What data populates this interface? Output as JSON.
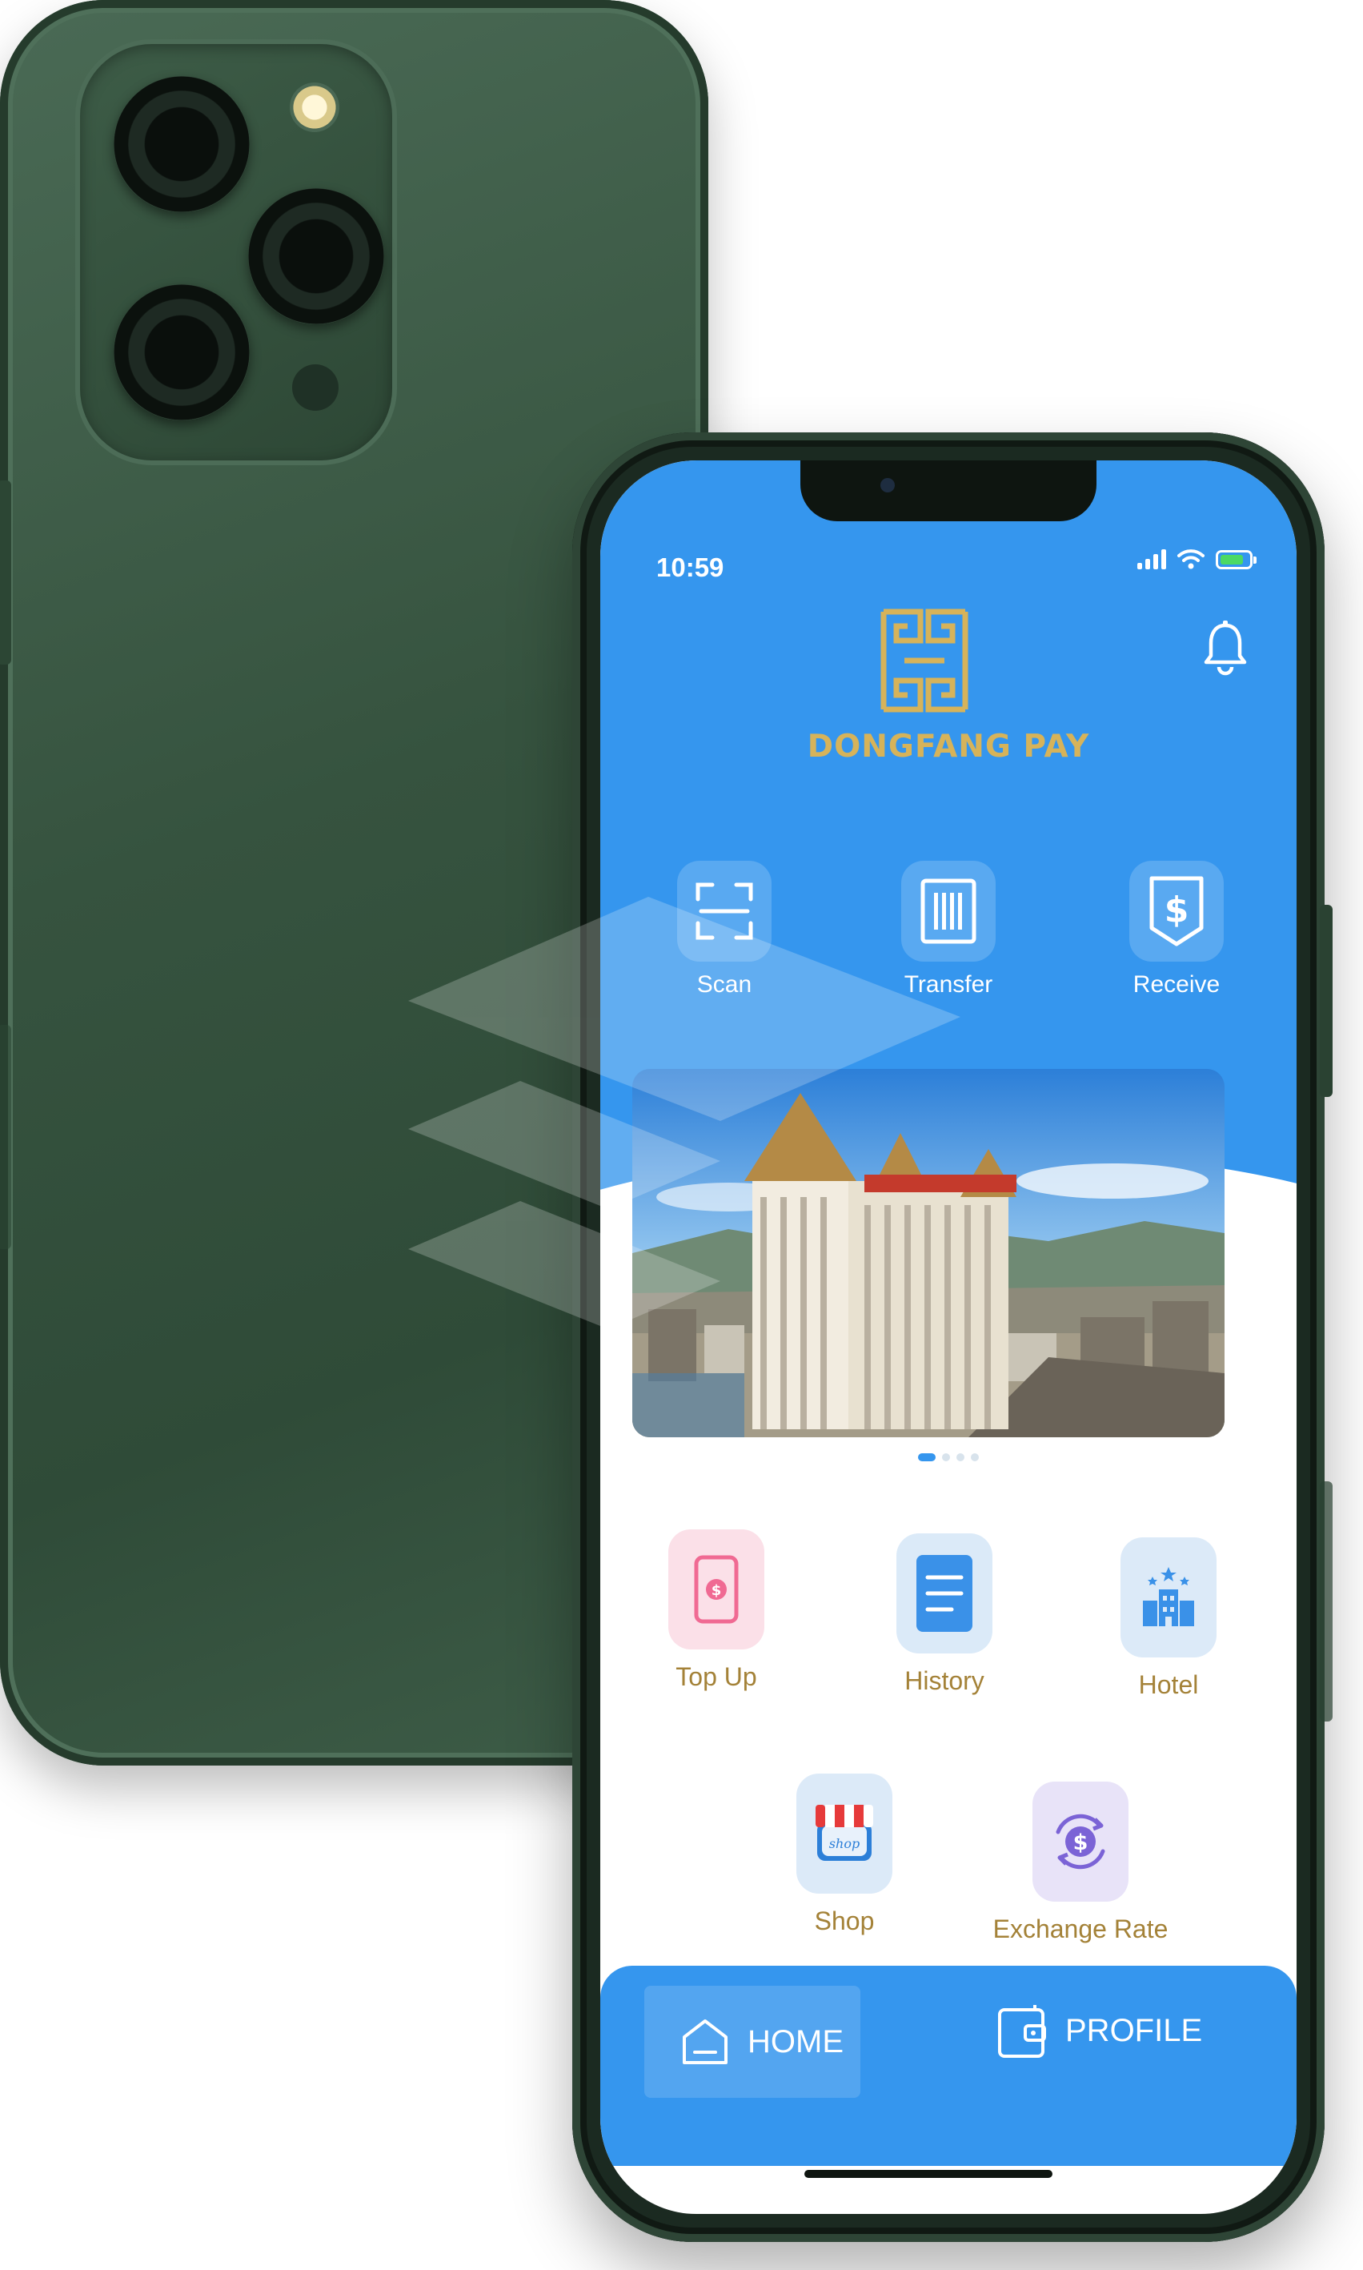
{
  "status_bar": {
    "time": "10:59"
  },
  "brand": {
    "name": "DONGFANG PAY",
    "gold": "#d6b35a",
    "blue": "#3596ee"
  },
  "quick_actions": [
    {
      "label": "Scan",
      "icon": "scan-icon"
    },
    {
      "label": "Transfer",
      "icon": "barcode-icon"
    },
    {
      "label": "Receive",
      "icon": "dollar-shield-icon"
    }
  ],
  "banner": {
    "image": "hotel-building-photo",
    "slides": 4,
    "active_slide": 1
  },
  "services": [
    {
      "label": "Top Up",
      "icon": "top-up-icon"
    },
    {
      "label": "History",
      "icon": "history-icon"
    },
    {
      "label": "Hotel",
      "icon": "hotel-icon"
    },
    {
      "label": "Shop",
      "icon": "shop-icon"
    },
    {
      "label": "Exchange Rate",
      "icon": "exchange-rate-icon"
    }
  ],
  "bottom_nav": {
    "home": "HOME",
    "profile": "PROFILE",
    "active": "HOME"
  }
}
